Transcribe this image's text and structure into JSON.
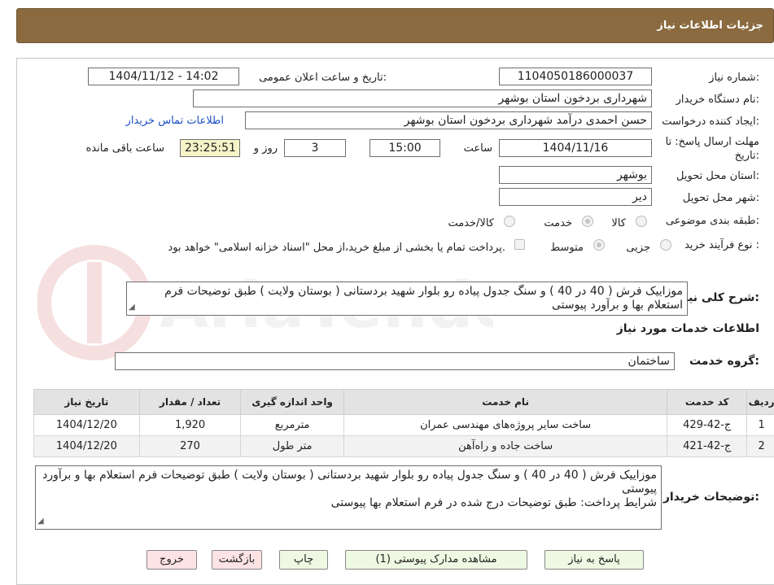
{
  "header": {
    "title": "جزئیات اطلاعات نیاز"
  },
  "form": {
    "need_number_label": "شماره نیاز:",
    "need_number": "1104050186000037",
    "announce_label": "تاریخ و ساعت اعلان عمومی:",
    "announce_value": "1404/11/12 - 14:02",
    "buyer_org_label": "نام دستگاه خریدار:",
    "buyer_org": "شهرداری بردخون استان بوشهر",
    "creator_label": "ایجاد کننده درخواست:",
    "creator": "حسن احمدی درآمد شهرداری بردخون استان بوشهر",
    "contact_link": "اطلاعات تماس خریدار",
    "deadline_label": "مهلت ارسال پاسخ: تا تاریخ:",
    "deadline_date": "1404/11/16",
    "time_label": "ساعت",
    "deadline_time": "15:00",
    "days_value": "3",
    "days_label": "روز و",
    "remaining_time": "23:25:51",
    "remaining_label": "ساعت باقی مانده",
    "province_label": "استان محل تحویل:",
    "province": "بوشهر",
    "city_label": "شهر محل تحویل:",
    "city": "دیر",
    "category_label": "طبقه بندی موضوعی:",
    "category_options": [
      "کالا",
      "خدمت",
      "کالا/خدمت"
    ],
    "category_selected": "خدمت",
    "process_label": "نوع فرآیند خرید :",
    "process_options": [
      "جزیی",
      "متوسط"
    ],
    "process_selected": "متوسط",
    "treasury_note": "پرداخت تمام یا بخشی از مبلغ خرید،از محل \"اسناد خزانه اسلامی\" خواهد بود."
  },
  "description": {
    "label": "شرح کلی نیاز:",
    "text": "موزاییک فرش ( 40 در 40 ) و سنگ جدول پیاده رو بلوار شهید بردستانی ( بوستان ولایت )  طبق توضیحات فرم استعلام بها و برآورد پیوستی"
  },
  "services": {
    "section_title": "اطلاعات خدمات مورد نیاز",
    "group_label": "گروه خدمت:",
    "group_value": "ساختمان",
    "columns": [
      "ردیف",
      "کد خدمت",
      "نام خدمت",
      "واحد اندازه گیری",
      "تعداد / مقدار",
      "تاریخ نیاز"
    ],
    "rows": [
      [
        "1",
        "ج-42-429",
        "ساخت سایر پروژه‌های مهندسی عمران",
        "مترمربع",
        "1,920",
        "1404/12/20"
      ],
      [
        "2",
        "ج-42-421",
        "ساخت جاده و راه‌آهن",
        "متر طول",
        "270",
        "1404/12/20"
      ]
    ]
  },
  "buyer_notes": {
    "label": "توضیحات خریدار:",
    "line1": "موزاییک فرش ( 40 در 40 ) و سنگ جدول پیاده رو بلوار شهید بردستانی ( بوستان ولایت )  طبق توضیحات فرم استعلام بها و برآورد پیوستی",
    "line2": "شرایط پرداخت: طبق توضیحات درج شده در فرم استعلام بها پیوستی"
  },
  "buttons": {
    "reply": "پاسخ به نیاز",
    "attachments": "مشاهده مدارک پیوستی (1)",
    "print": "چاپ",
    "back": "بازگشت",
    "exit": "خروج"
  },
  "watermark": {
    "text": "AriaTender.neT"
  }
}
